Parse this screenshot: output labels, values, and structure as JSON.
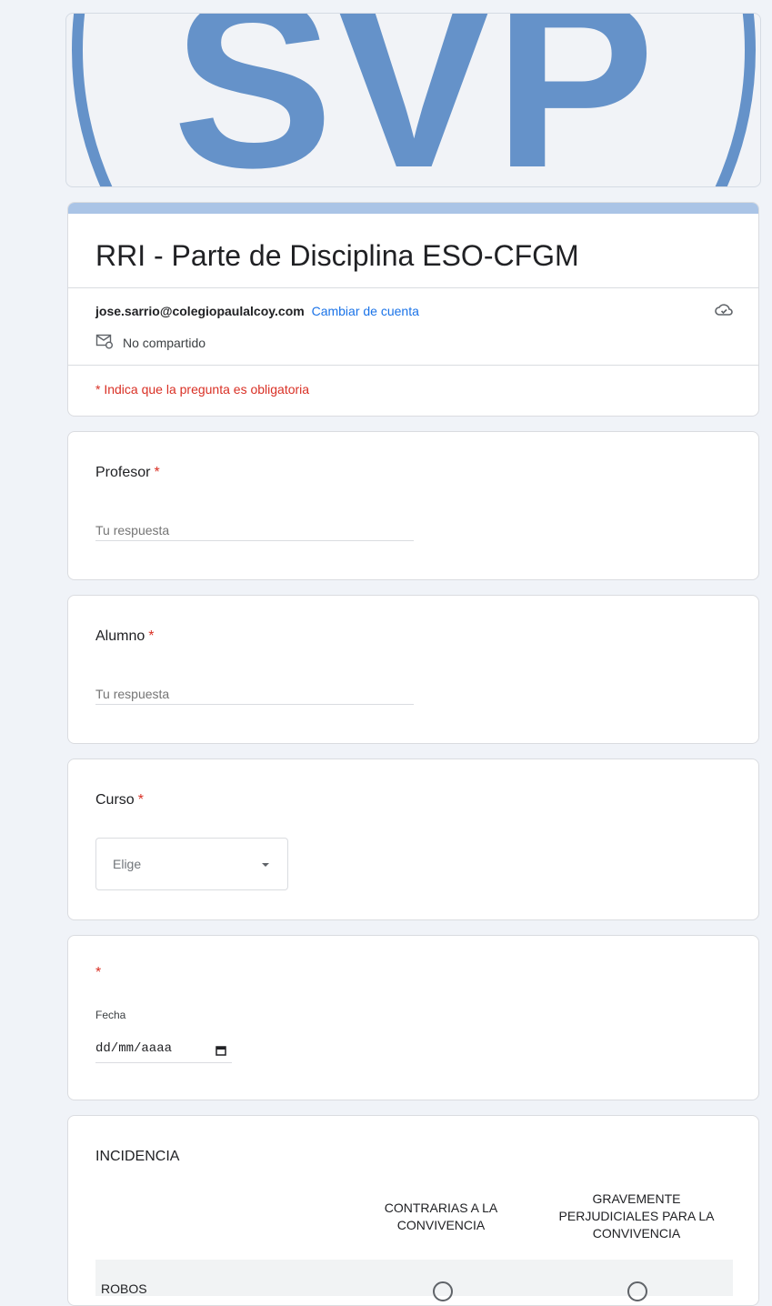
{
  "banner": {
    "logo_text": "SVP"
  },
  "form": {
    "title": "RRI - Parte de Disciplina ESO-CFGM",
    "account_email": "jose.sarrio@colegiopaulalcoy.com",
    "switch_account": "Cambiar de cuenta",
    "not_shared": "No compartido",
    "required_note": "* Indica que la pregunta es obligatoria"
  },
  "questions": {
    "profesor": {
      "label": "Profesor",
      "star": "*",
      "placeholder": "Tu respuesta"
    },
    "alumno": {
      "label": "Alumno",
      "star": "*",
      "placeholder": "Tu respuesta"
    },
    "curso": {
      "label": "Curso",
      "star": "*",
      "selected": "Elige"
    },
    "fecha": {
      "star": "*",
      "label": "Fecha",
      "value": "dd/mm/aaaa"
    },
    "incidencia": {
      "label": "INCIDENCIA",
      "columns": [
        "CONTRARIAS A LA CONVIVENCIA",
        "GRAVEMENTE PERJUDICIALES PARA LA CONVIVENCIA"
      ],
      "rows": [
        "ROBOS"
      ]
    }
  },
  "colors": {
    "accent_bar": "#aac4e6",
    "required": "#d93025",
    "link": "#1a73e8",
    "logo": "#6592c9"
  }
}
